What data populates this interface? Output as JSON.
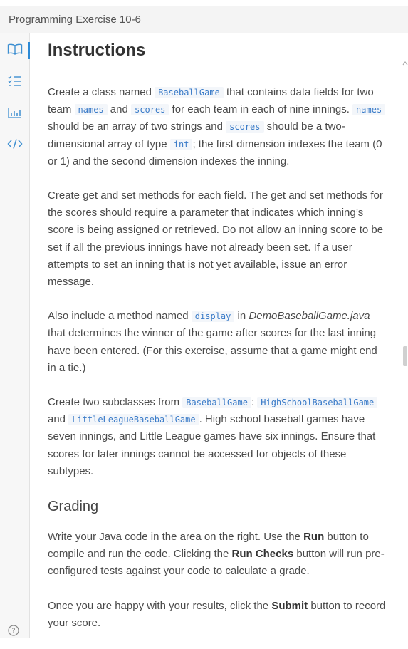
{
  "window": {
    "title": "Programming Exercise 10-6"
  },
  "sidebar": {
    "items": [
      {
        "name": "instructions",
        "icon": "book-icon"
      },
      {
        "name": "checklist",
        "icon": "checklist-icon"
      },
      {
        "name": "results",
        "icon": "bar-chart-icon"
      },
      {
        "name": "code",
        "icon": "code-icon"
      }
    ],
    "help_icon": "question-circle-icon"
  },
  "header": {
    "title": "Instructions"
  },
  "content": {
    "p1": {
      "t1": "Create a class named ",
      "c1": "BaseballGame",
      "t2": " that contains data fields for two team ",
      "c2": "names",
      "t3": " and ",
      "c3": "scores",
      "t4": " for each team in each of nine innings. ",
      "c4": "names",
      "t5": " should be an array of two strings and ",
      "c5": "scores",
      "t6": " should be a two-dimensional array of type ",
      "c6": "int",
      "t7": "; the first dimension indexes the team (0 or 1) and the second dimension indexes the inning."
    },
    "p2": "Create get and set methods for each field. The get and set methods for the scores should require a parameter that indicates which inning’s score is being assigned or retrieved. Do not allow an inning score to be set if all the previous innings have not already been set. If a user attempts to set an inning that is not yet available, issue an error message.",
    "p3": {
      "t1": "Also include a method named ",
      "c1": "display",
      "t2": " in ",
      "em1": "DemoBaseballGame.java",
      "t3": " that determines the winner of the game after scores for the last inning have been entered. (For this exercise, assume that a game might end in a tie.)"
    },
    "p4": {
      "t1": "Create two subclasses from ",
      "c1": "BaseballGame",
      "t2": ": ",
      "c2": "HighSchoolBaseballGame",
      "t3": " and ",
      "c3": "LittleLeagueBaseballGame",
      "t4": ". High school baseball games have seven innings, and Little League games have six innings. Ensure that scores for later innings cannot be accessed for objects of these subtypes."
    },
    "grading_heading": "Grading",
    "p5": {
      "t1": "Write your Java code in the area on the right. Use the ",
      "b1": "Run",
      "t2": " button to compile and run the code. Clicking the ",
      "b2": "Run Checks",
      "t3": " button will run pre-configured tests against your code to calculate a grade."
    },
    "p6": {
      "t1": "Once you are happy with your results, click the ",
      "b1": "Submit",
      "t2": " button to record your score."
    }
  },
  "colors": {
    "accent": "#2d8ad6",
    "code_text": "#3a7bc8",
    "icon": "#3d8fd1"
  }
}
